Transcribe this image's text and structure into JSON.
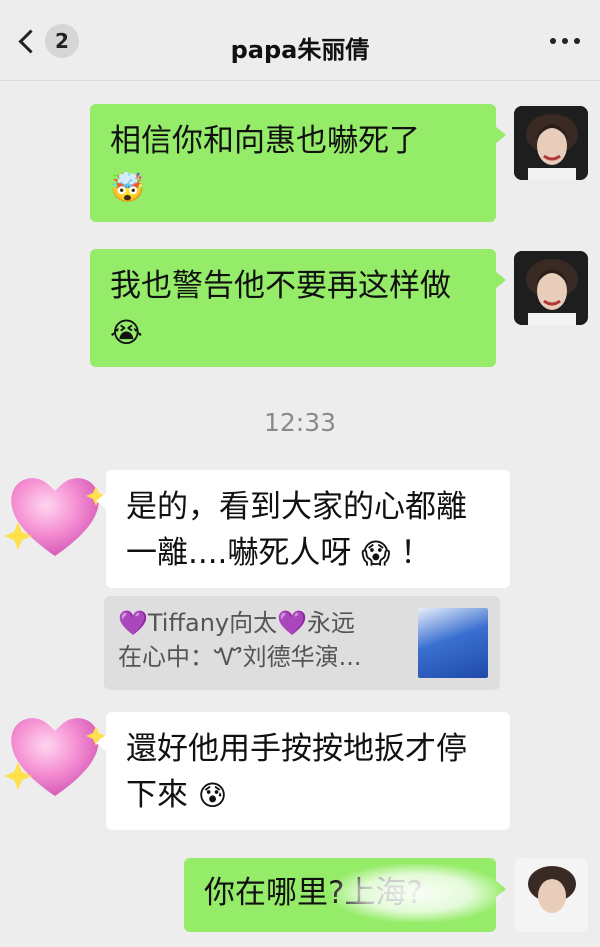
{
  "header": {
    "back_count": "2",
    "title": "papa朱丽倩"
  },
  "messages": [
    {
      "side": "right",
      "text": "相信你和向惠也嚇死了",
      "emoji": "🤯"
    },
    {
      "side": "right",
      "text": "我也警告他不要再这样做",
      "emoji": "😭"
    },
    {
      "side": "left",
      "text": "是的，看到大家的心都離一離....嚇死人呀",
      "emoji": "😱",
      "tail": "！"
    },
    {
      "side": "left",
      "text": "還好他用手按按地扳才停下來",
      "emoji": "😰"
    },
    {
      "side": "right",
      "text": "你在哪里?上海?"
    }
  ],
  "timestamp": "12:33",
  "quote": {
    "line1": "💜Tiffany向太💜永远",
    "line2": "在心中：Ꮙ刘德华演..."
  },
  "colors": {
    "my_bubble": "#95ec69",
    "their_bubble": "#ffffff",
    "background": "#ededed"
  },
  "icons": [
    "back-chevron-icon",
    "more-icon",
    "heart-avatar-icon"
  ]
}
